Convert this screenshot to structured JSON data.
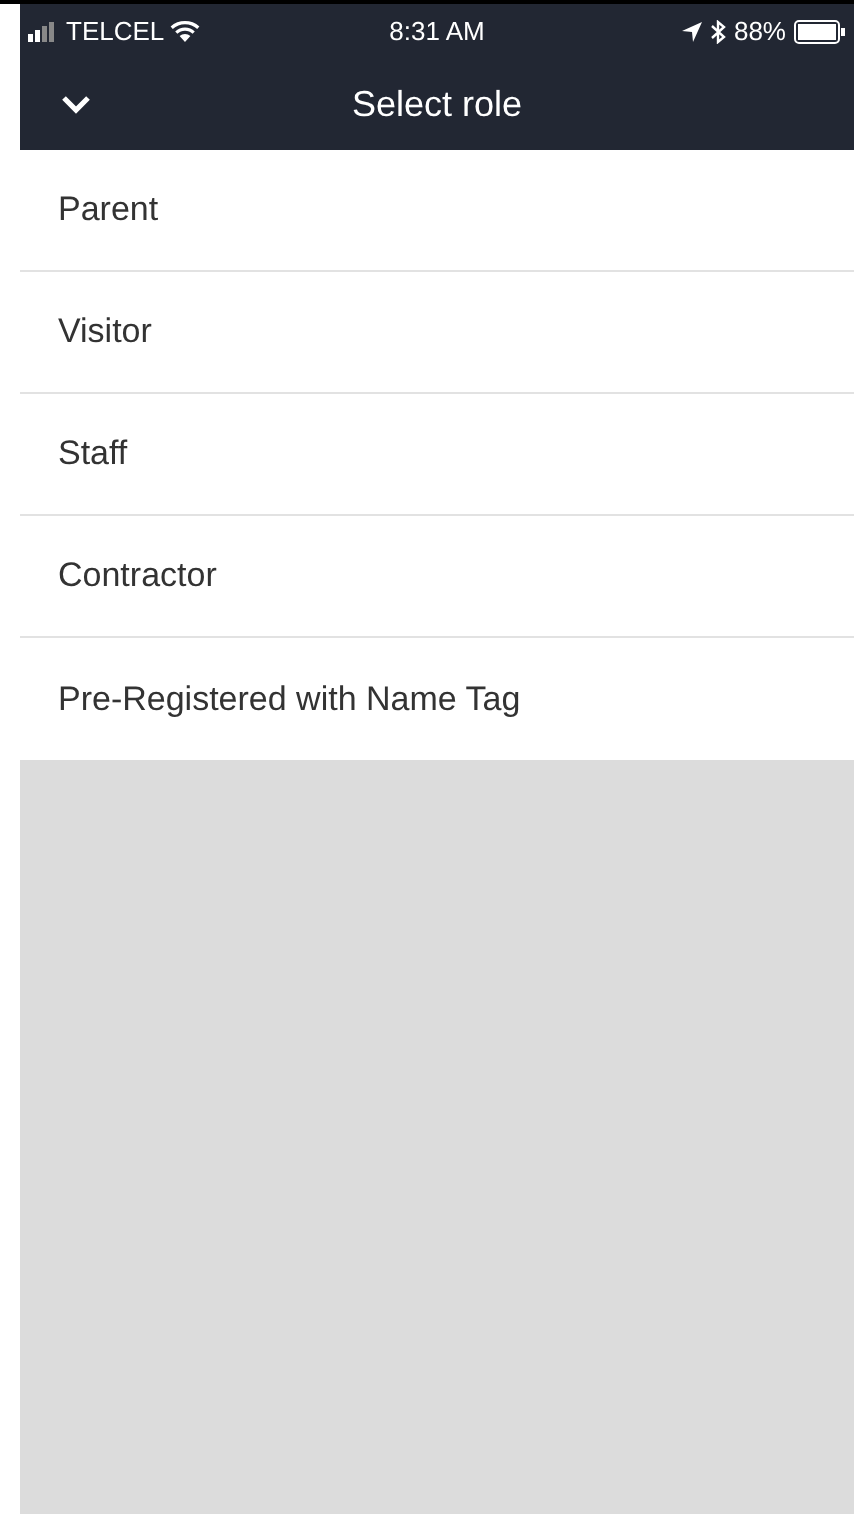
{
  "status_bar": {
    "carrier": "TELCEL",
    "time": "8:31 AM",
    "battery": "88%"
  },
  "nav": {
    "title": "Select role"
  },
  "roles": [
    {
      "label": "Parent"
    },
    {
      "label": "Visitor"
    },
    {
      "label": "Staff"
    },
    {
      "label": "Contractor"
    },
    {
      "label": "Pre-Registered with Name Tag"
    }
  ]
}
